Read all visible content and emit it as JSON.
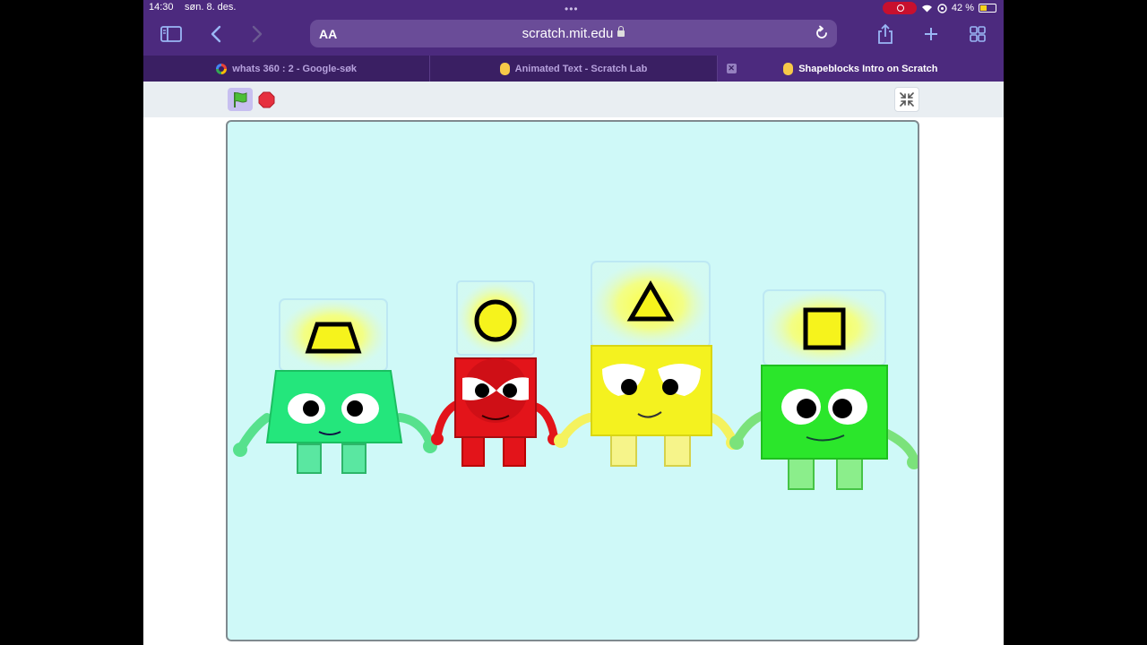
{
  "status_bar": {
    "time": "14:30",
    "date": "søn. 8. des.",
    "battery_text": "42 %",
    "icons": [
      "screen-recording-icon",
      "wifi-icon",
      "location-icon",
      "battery-icon"
    ]
  },
  "toolbar": {
    "dots": "•••",
    "address_aa": "AA",
    "url": "scratch.mit.edu",
    "icons": [
      "sidebar-icon",
      "back-icon",
      "forward-icon",
      "lock-icon",
      "reload-icon",
      "share-icon",
      "new-tab-icon",
      "tabs-overview-icon"
    ]
  },
  "tabs": [
    {
      "label": "whats 360 : 2 - Google-søk",
      "favicon": "google-icon",
      "active": false
    },
    {
      "label": "Animated Text - Scratch Lab",
      "favicon": "scratch-icon",
      "active": false
    },
    {
      "label": "Shapeblocks Intro on Scratch",
      "favicon": "scratch-icon",
      "active": true
    }
  ],
  "stage": {
    "controls": [
      "green-flag-icon",
      "stop-icon",
      "exit-fullscreen-icon"
    ],
    "background": "#cff9f8",
    "characters": [
      {
        "name": "trapezium",
        "shape": "trapezoid",
        "body_color": "#2ee77f"
      },
      {
        "name": "circle",
        "shape": "circle",
        "body_color": "#e3141a"
      },
      {
        "name": "triangle",
        "shape": "triangle",
        "body_color": "#f4f21f"
      },
      {
        "name": "square",
        "shape": "square",
        "body_color": "#2be62b"
      }
    ]
  },
  "colors": {
    "browser_chrome": "#4c2a7e",
    "tab_bar": "#3a1f63",
    "accent_icons": "#9ab7f5"
  }
}
